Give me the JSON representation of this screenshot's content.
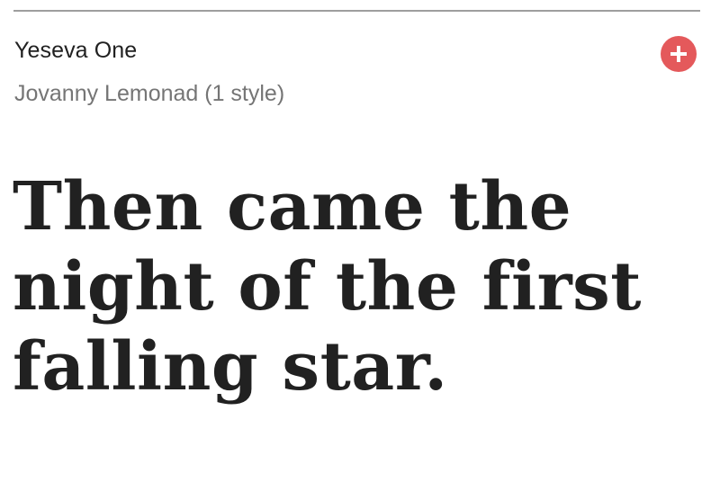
{
  "font_card": {
    "name": "Yeseva One",
    "designer": "Jovanny Lemonad (1 style)",
    "add_icon": "plus-icon",
    "sample_text": "Then came the night of the first falling star.",
    "colors": {
      "add_button": "#e4595b",
      "name_text": "#212121",
      "designer_text": "#757575",
      "rule": "#9e9e9e"
    }
  }
}
